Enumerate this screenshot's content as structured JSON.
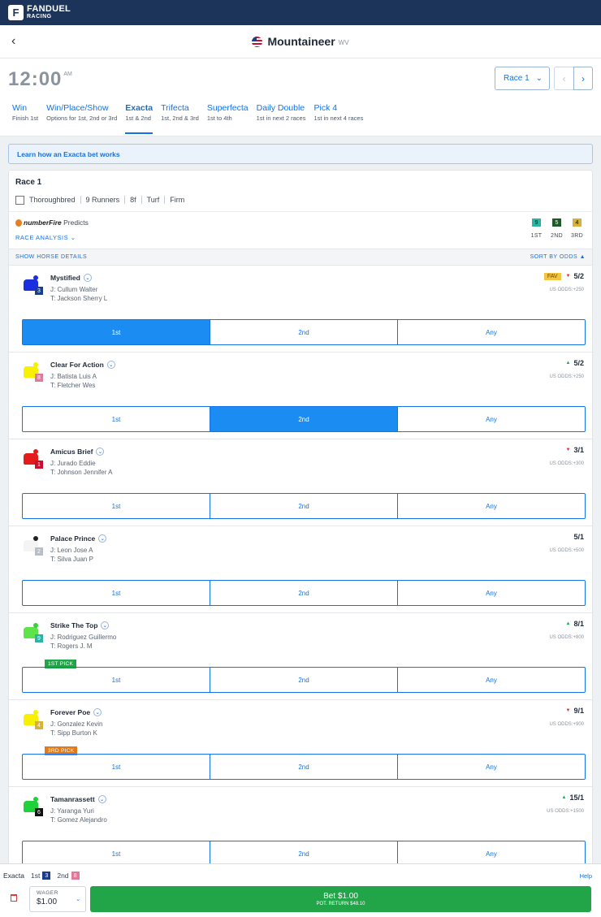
{
  "brand": {
    "line1": "FANDUEL",
    "line2": "RACING",
    "mark": "F"
  },
  "track": {
    "name": "Mountaineer",
    "state": "WV",
    "back": "‹"
  },
  "time": {
    "value": "12:00",
    "ampm": "AM"
  },
  "race_select": {
    "label": "Race 1",
    "chev": "⌄",
    "prev": "‹",
    "next": "›"
  },
  "tabs": [
    {
      "label": "Win",
      "sub": "Finish 1st"
    },
    {
      "label": "Win/Place/Show",
      "sub": "Options for 1st, 2nd or 3rd"
    },
    {
      "label": "Exacta",
      "sub": "1st & 2nd"
    },
    {
      "label": "Trifecta",
      "sub": "1st, 2nd & 3rd"
    },
    {
      "label": "Superfecta",
      "sub": "1st to 4th"
    },
    {
      "label": "Daily Double",
      "sub": "1st in next 2 races"
    },
    {
      "label": "Pick 4",
      "sub": "1st in next 4 races"
    }
  ],
  "learn": "Learn how an Exacta bet works",
  "race": {
    "title": "Race 1",
    "breed": "Thoroughbred",
    "runners": "9 Runners",
    "distance": "8f",
    "surface": "Turf",
    "condition": "Firm"
  },
  "predicts": {
    "brand": "numberFire",
    "label": "Predicts",
    "analysis": "RACE ANALYSIS ⌄",
    "picks": [
      {
        "num": "9",
        "label": "1ST",
        "color": "#2bb3a3"
      },
      {
        "num": "5",
        "label": "2ND",
        "color": "#1e5b2a"
      },
      {
        "num": "4",
        "label": "3RD",
        "color": "#d7b13a"
      }
    ]
  },
  "details": {
    "show": "SHOW HORSE DETAILS",
    "sort": "SORT BY ODDS ▲"
  },
  "colors": {
    "accent": "#1473e6",
    "selected": "#1b8cf2",
    "bet": "#22a549"
  },
  "horses": [
    {
      "name": "Mystified",
      "jockey": "J: Cullum Walter",
      "trainer": "T: Jackson Sherry L",
      "num": "3",
      "num_color": "#1c3e8a",
      "silk": "#1a2ee0",
      "cap": "#1a2ee0",
      "odds": "5/2",
      "arrow": "▼",
      "dir": "down",
      "fav": "FAV",
      "us": "US ODDS:+250",
      "badge": "",
      "badge_color": "",
      "selected": "1st"
    },
    {
      "name": "Clear For Action",
      "jockey": "J: Batista Luis A",
      "trainer": "T: Fletcher Wes",
      "num": "8",
      "num_color": "#e07a9a",
      "silk": "#f7f000",
      "cap": "#f7f000",
      "odds": "5/2",
      "arrow": "▲",
      "dir": "up",
      "fav": "",
      "us": "US ODDS:+250",
      "badge": "",
      "badge_color": "",
      "selected": "2nd"
    },
    {
      "name": "Amicus Brief",
      "jockey": "J: Jurado Eddie",
      "trainer": "T: Johnson Jennifer A",
      "num": "1",
      "num_color": "#c8102e",
      "silk": "#e41b1b",
      "cap": "#e41b1b",
      "odds": "3/1",
      "arrow": "▼",
      "dir": "down",
      "fav": "",
      "us": "US ODDS:+300",
      "badge": "",
      "badge_color": "",
      "selected": ""
    },
    {
      "name": "Palace Prince",
      "jockey": "J: Leon Jose A",
      "trainer": "T: Silva Juan P",
      "num": "2",
      "num_color": "#b8bfc6",
      "silk": "#f4f4f4",
      "cap": "#222",
      "odds": "5/1",
      "arrow": "",
      "dir": "",
      "fav": "",
      "us": "US ODDS:+500",
      "badge": "",
      "badge_color": "",
      "selected": ""
    },
    {
      "name": "Strike The Top",
      "jockey": "J: Rodriguez Guillermo",
      "trainer": "T: Rogers J. M",
      "num": "9",
      "num_color": "#2bb3a3",
      "silk": "#5ee34a",
      "cap": "#3ccf3c",
      "odds": "8/1",
      "arrow": "▲",
      "dir": "up",
      "fav": "",
      "us": "US ODDS:+800",
      "badge": "1ST PICK",
      "badge_color": "#22a549",
      "selected": ""
    },
    {
      "name": "Forever Poe",
      "jockey": "J: Gonzalez Kevin",
      "trainer": "T: Sipp Burton K",
      "num": "4",
      "num_color": "#d7b13a",
      "silk": "#f7f000",
      "cap": "#f7f000",
      "odds": "9/1",
      "arrow": "▼",
      "dir": "down",
      "fav": "",
      "us": "US ODDS:+900",
      "badge": "3RD PICK",
      "badge_color": "#e07b1c",
      "selected": ""
    },
    {
      "name": "Tamanrassett",
      "jockey": "J: Yaranga Yuri",
      "trainer": "T: Gomez Alejandro",
      "num": "6",
      "num_color": "#111",
      "silk": "#1fd13a",
      "cap": "#1fd13a",
      "odds": "15/1",
      "arrow": "▲",
      "dir": "up",
      "fav": "",
      "us": "US ODDS:+1500",
      "badge": "",
      "badge_color": "",
      "selected": ""
    }
  ],
  "buttons": [
    "1st",
    "2nd",
    "Any"
  ],
  "footer": {
    "bet_type": "Exacta",
    "p1": "1st",
    "p1n": "3",
    "p1c": "#1c3e8a",
    "p2": "2nd",
    "p2n": "8",
    "p2c": "#e07a9a",
    "help": "Help",
    "wager_label": "WAGER",
    "wager_value": "$1.00",
    "wager_chev": "⌄",
    "bet": "Bet $1.00",
    "return": "POT. RETURN $48.10"
  }
}
